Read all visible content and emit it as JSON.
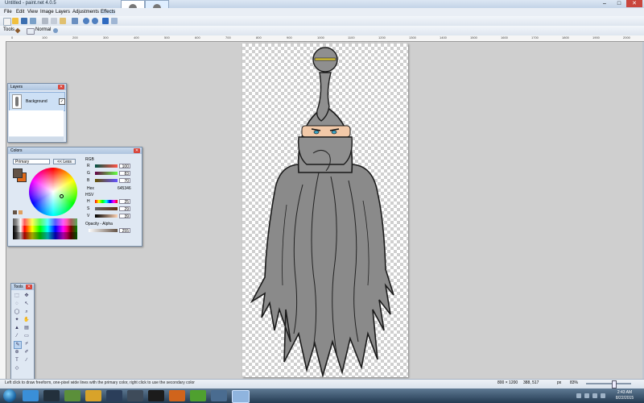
{
  "window": {
    "title": "Untitled - paint.net 4.0.5",
    "controls": {
      "minimize": "–",
      "maximize": "□",
      "close": "✕"
    }
  },
  "menu": [
    "File",
    "Edit",
    "View",
    "Image",
    "Layers",
    "Adjustments",
    "Effects"
  ],
  "toolbar": {
    "tools_label": "Tools",
    "blend_mode": "Normal"
  },
  "ruler_top": [
    "0",
    "100",
    "200",
    "300",
    "400",
    "500",
    "600",
    "700",
    "800",
    "900",
    "1000",
    "1100",
    "1200",
    "1300",
    "1400",
    "1500",
    "1600",
    "1700",
    "1800",
    "1900",
    "2000"
  ],
  "layers_panel": {
    "title": "Layers",
    "close": "✕",
    "layer_name": "Background"
  },
  "colors_panel": {
    "title": "Colors",
    "close": "✕",
    "mode": "Primary",
    "less_button": "<< Less",
    "rgb_label": "RGB",
    "r_label": "R",
    "r_value": "100",
    "g_label": "G",
    "g_value": "83",
    "b_label": "B",
    "b_value": "70",
    "hex_label": "Hex",
    "hex_value": "645346",
    "hsv_label": "HSV",
    "h_label": "H",
    "h_value": "25",
    "s_label": "S",
    "s_value": "29",
    "v_label": "V",
    "v_value": "39",
    "opacity_label": "Opacity - Alpha",
    "opacity_value": "255",
    "primary_color": "#645346",
    "secondary_color": "#e06a1a"
  },
  "tools_panel": {
    "title": "Tools",
    "close": "✕",
    "letter_tool": "T"
  },
  "status": {
    "hint": "Left click to draw freeform, one-pixel wide lines with the primary color, right click to use the secondary color",
    "image_size": "800 × 1200",
    "cursor_position": "388, 517",
    "units": "px",
    "zoom": "83%"
  },
  "taskbar": {
    "time": "2:43 AM",
    "date": "8/22/2015"
  }
}
